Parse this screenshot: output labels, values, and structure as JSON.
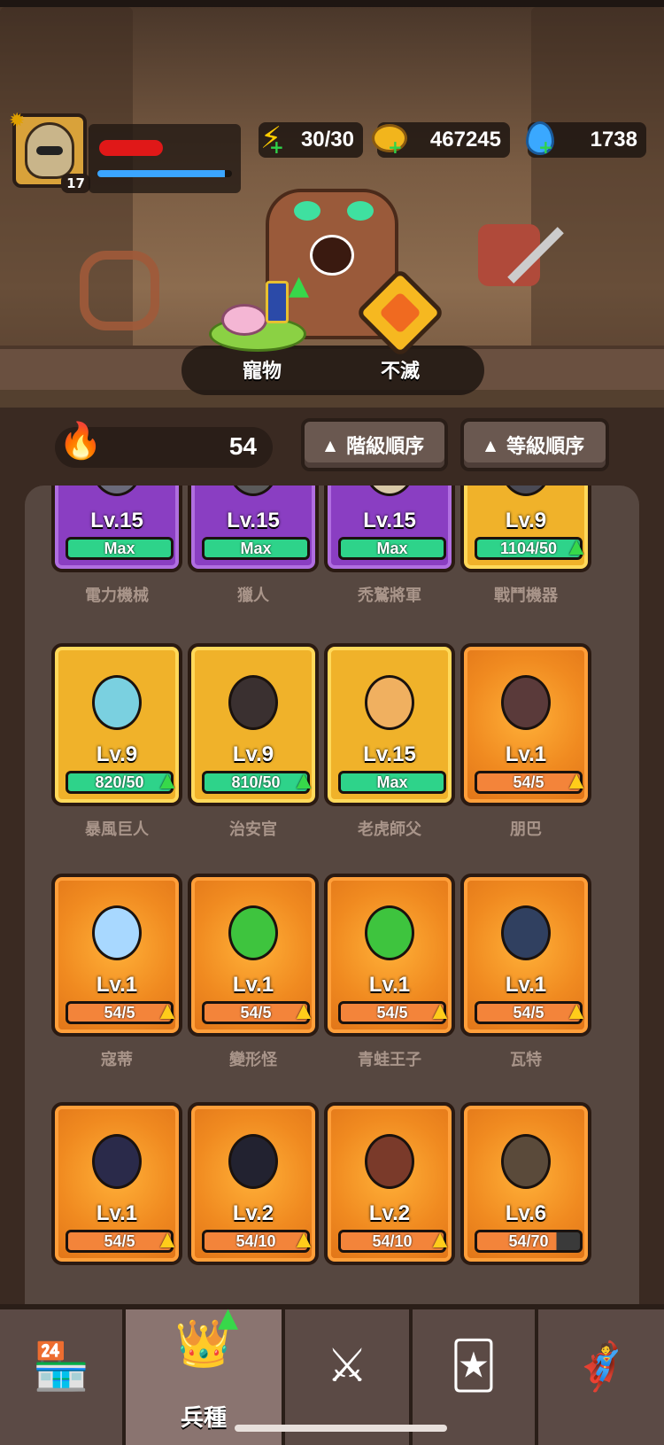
{
  "header": {
    "player_level": "17",
    "xp_fraction": 0.95,
    "energy": "30/30",
    "gold": "467245",
    "gems": "1738"
  },
  "features": {
    "pet_label": "寵物",
    "immortal_label": "不滅"
  },
  "sort": {
    "power": "54",
    "grade_sort_label": "階級順序",
    "level_sort_label": "等級順序"
  },
  "units": [
    {
      "name": "電力機械",
      "level": "Lv.15",
      "progress": "Max",
      "rarity": "purple",
      "bar": "green",
      "arrow": ""
    },
    {
      "name": "獵人",
      "level": "Lv.15",
      "progress": "Max",
      "rarity": "purple",
      "bar": "green",
      "arrow": ""
    },
    {
      "name": "禿鷲將軍",
      "level": "Lv.15",
      "progress": "Max",
      "rarity": "purple",
      "bar": "green",
      "arrow": ""
    },
    {
      "name": "戰鬥機器",
      "level": "Lv.9",
      "progress": "1104/50",
      "rarity": "yellow",
      "bar": "green",
      "arrow": "green"
    },
    {
      "name": "暴風巨人",
      "level": "Lv.9",
      "progress": "820/50",
      "rarity": "yellow",
      "bar": "green",
      "arrow": "green"
    },
    {
      "name": "治安官",
      "level": "Lv.9",
      "progress": "810/50",
      "rarity": "yellow",
      "bar": "green",
      "arrow": "green"
    },
    {
      "name": "老虎師父",
      "level": "Lv.15",
      "progress": "Max",
      "rarity": "yellow",
      "bar": "green",
      "arrow": ""
    },
    {
      "name": "朋巴",
      "level": "Lv.1",
      "progress": "54/5",
      "rarity": "orange",
      "bar": "orange",
      "arrow": "yellow"
    },
    {
      "name": "寇蒂",
      "level": "Lv.1",
      "progress": "54/5",
      "rarity": "orange",
      "bar": "orange",
      "arrow": "yellow"
    },
    {
      "name": "變形怪",
      "level": "Lv.1",
      "progress": "54/5",
      "rarity": "orange",
      "bar": "orange",
      "arrow": "yellow"
    },
    {
      "name": "青蛙王子",
      "level": "Lv.1",
      "progress": "54/5",
      "rarity": "orange",
      "bar": "orange",
      "arrow": "yellow"
    },
    {
      "name": "瓦特",
      "level": "Lv.1",
      "progress": "54/5",
      "rarity": "orange",
      "bar": "orange",
      "arrow": "yellow"
    },
    {
      "name": "",
      "level": "Lv.1",
      "progress": "54/5",
      "rarity": "orange",
      "bar": "orange",
      "arrow": "yellow"
    },
    {
      "name": "",
      "level": "Lv.2",
      "progress": "54/10",
      "rarity": "orange",
      "bar": "orange",
      "arrow": "yellow"
    },
    {
      "name": "",
      "level": "Lv.2",
      "progress": "54/10",
      "rarity": "orange",
      "bar": "orange",
      "arrow": "yellow"
    },
    {
      "name": "",
      "level": "Lv.6",
      "progress": "54/70",
      "rarity": "orange",
      "bar": "partial",
      "arrow": ""
    }
  ],
  "nav": {
    "shop_icon": "shop-stall-icon",
    "units_label": "兵種",
    "battle_icon": "crossed-swords-icon",
    "cards_icon": "card-crown-icon",
    "heroes_icon": "heroes-icon"
  },
  "colors": {
    "purple_card": "#8a3ec2",
    "yellow_card": "#f0b22a",
    "orange_card": "#f08a20",
    "max_bar": "#2ed38a",
    "upgrade_arrow": "#37d84a"
  }
}
